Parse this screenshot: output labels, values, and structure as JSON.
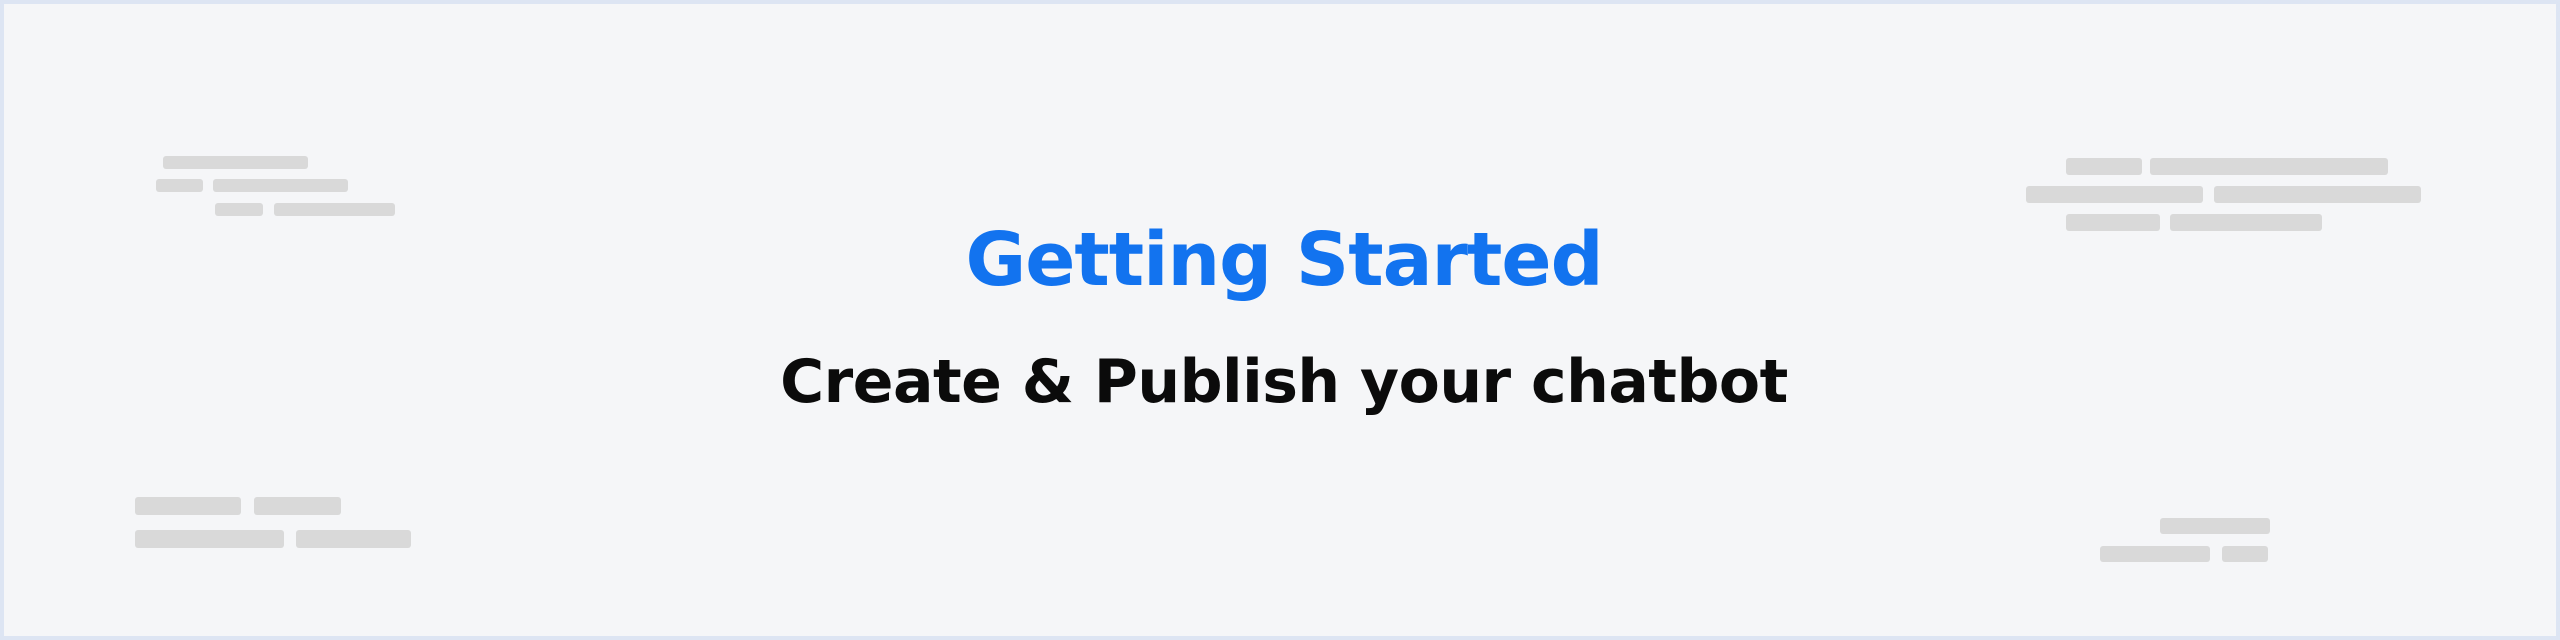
{
  "heading": {
    "title": "Getting Started",
    "subtitle": "Create & Publish your chatbot"
  },
  "colors": {
    "background": "#f5f6f8",
    "border": "#dde5f3",
    "title": "#1273ef",
    "subtitle": "#0b0b0b",
    "placeholder_bar": "#d9d9d9"
  }
}
